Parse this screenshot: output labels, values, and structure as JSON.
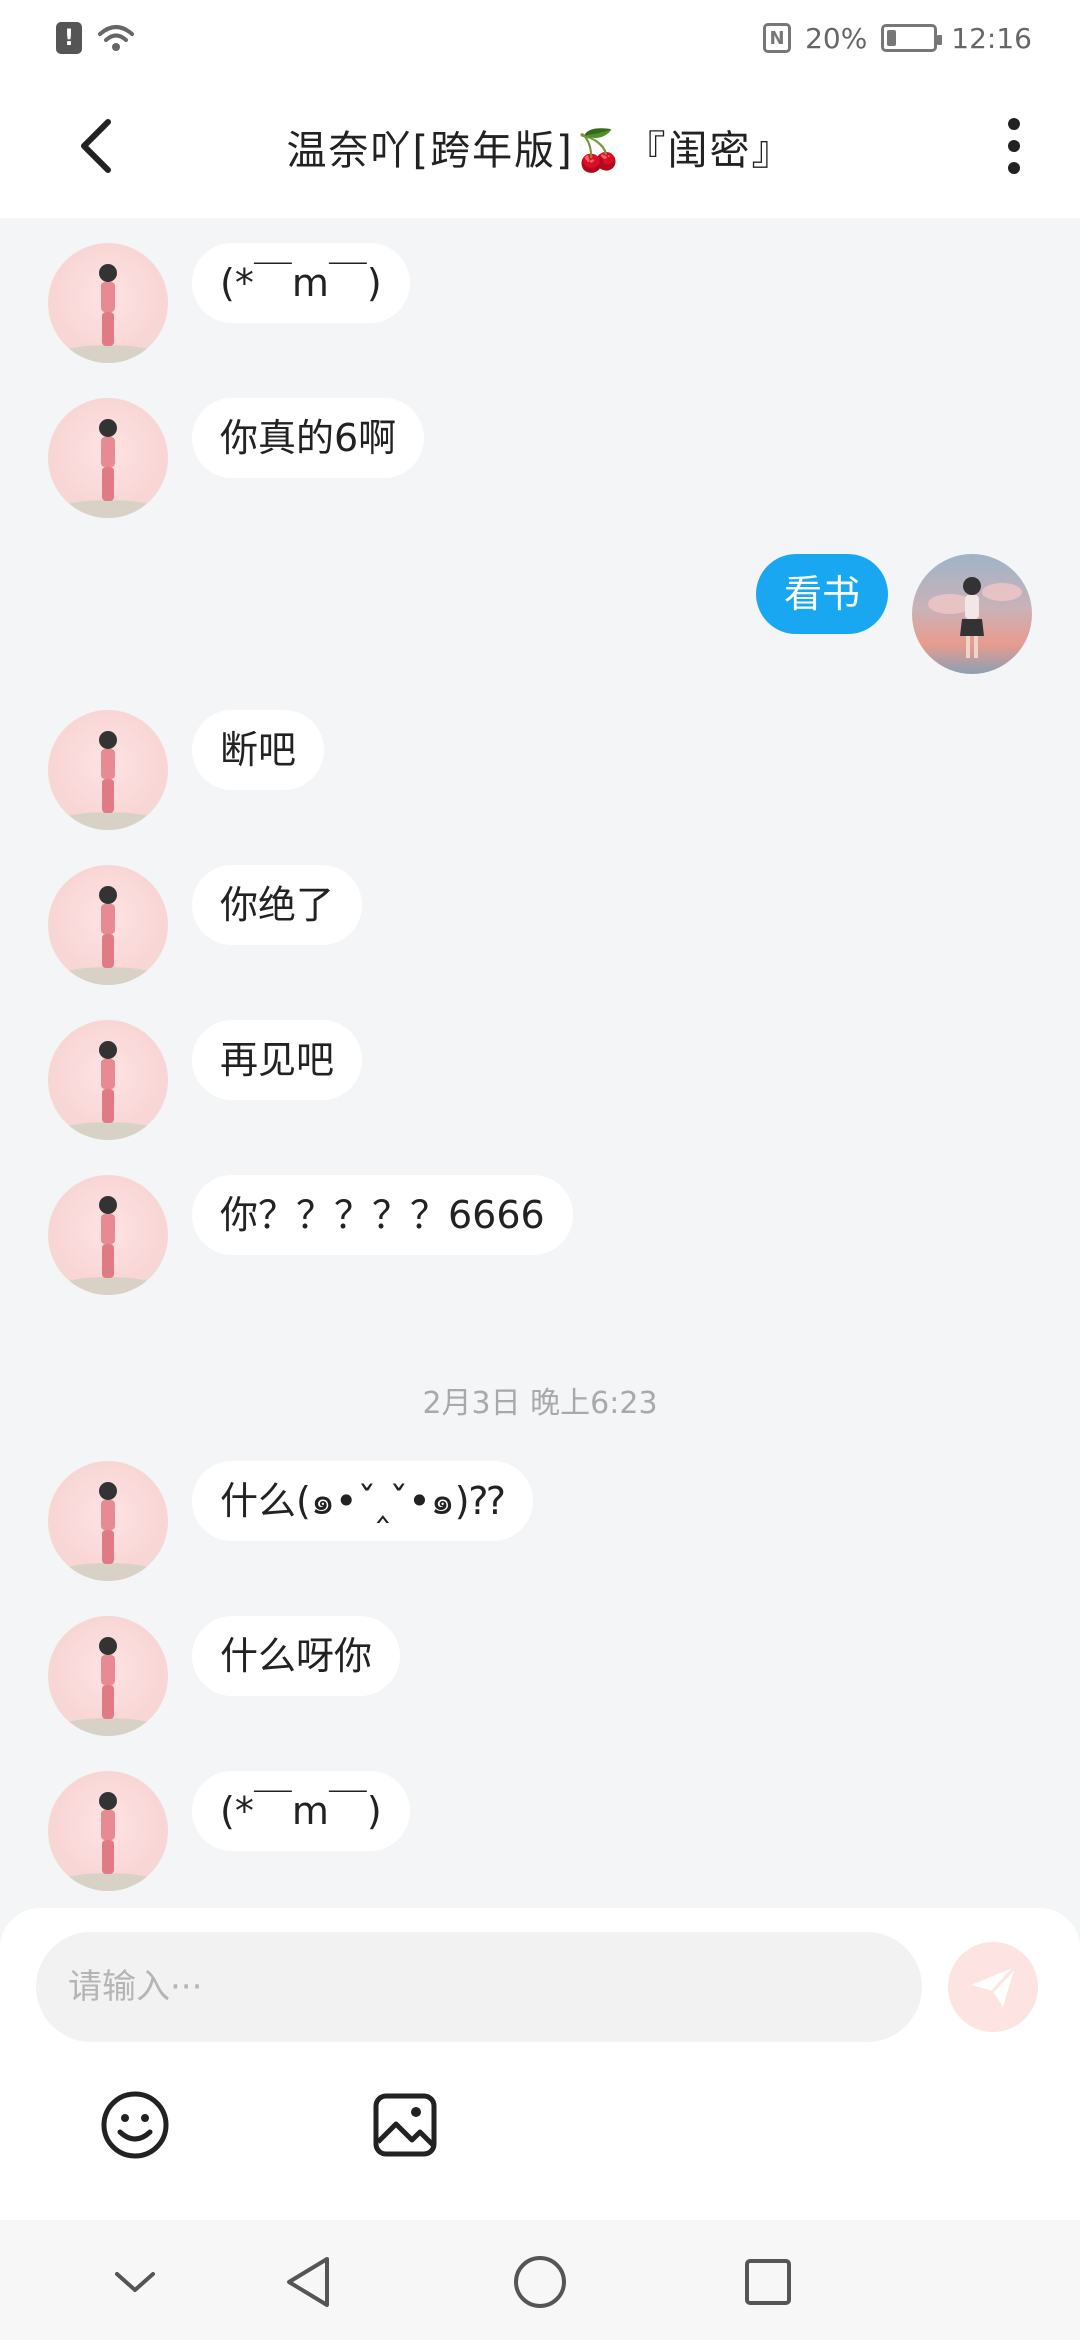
{
  "status_bar": {
    "battery": "20%",
    "time": "12:16"
  },
  "header": {
    "title": "温奈吖[跨年版]🍒『闺密』"
  },
  "messages": [
    {
      "side": "left",
      "text": "(*￣m￣)"
    },
    {
      "side": "left",
      "text": "你真的6啊"
    },
    {
      "side": "right",
      "text": "看书"
    },
    {
      "side": "left",
      "text": "断吧"
    },
    {
      "side": "left",
      "text": "你绝了"
    },
    {
      "side": "left",
      "text": "再见吧"
    },
    {
      "side": "left",
      "text": "你？？？？？6666"
    },
    {
      "side": "left",
      "text": "什么(๑•ˇ‸ˇ•๑)⁇"
    },
    {
      "side": "left",
      "text": "什么呀你"
    },
    {
      "side": "left",
      "text": "(*￣m￣)"
    }
  ],
  "time_divider": "2月3日  晚上6:23",
  "input": {
    "placeholder": "请输入···",
    "value": ""
  },
  "icons": {
    "back": "chevron-left-icon",
    "more": "more-vertical-icon",
    "send": "paper-plane-icon",
    "emoji": "smiley-icon",
    "image": "image-icon",
    "nav_down": "chevron-down-icon",
    "nav_back": "triangle-back-icon",
    "nav_home": "circle-home-icon",
    "nav_recent": "square-recent-icon"
  },
  "colors": {
    "accent": "#1aa7f2",
    "send_button": "#fde3e1",
    "background": "#f4f5f7"
  }
}
